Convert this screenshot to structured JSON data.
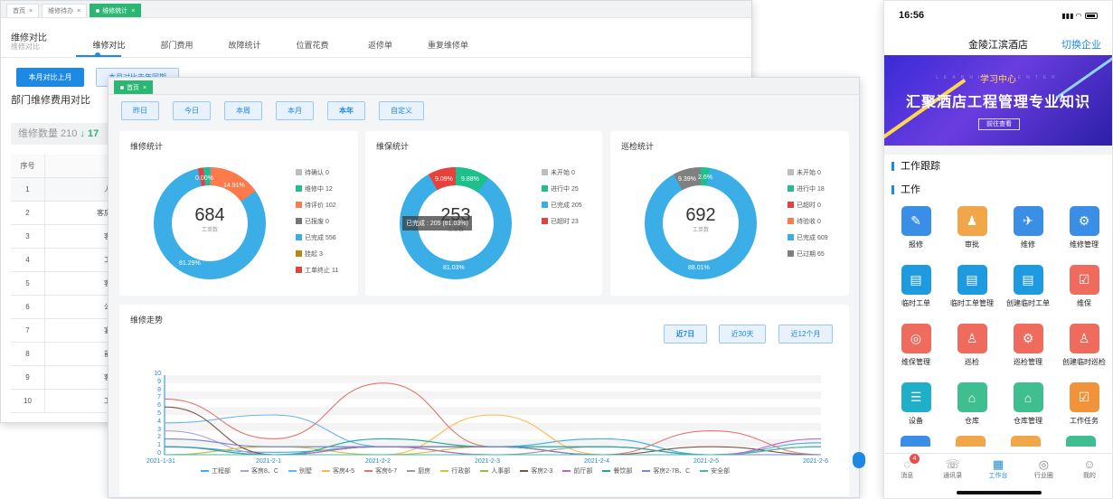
{
  "back_window": {
    "tabs": [
      {
        "label": "首页",
        "active": false
      },
      {
        "label": "维修待办",
        "active": false
      },
      {
        "label": "维修统计",
        "active": true
      }
    ],
    "title": "维修对比",
    "subtitle": "维修对比",
    "nav": [
      "维修对比",
      "部门费用",
      "故障统计",
      "位置花费",
      "返修单",
      "重复维修单"
    ],
    "btn_primary": "本月对比上月",
    "btn_secondary": "本月对比去年同期",
    "section_title": "部门维修费用对比",
    "count_label": "维修数量 210",
    "count_arrow": "↓",
    "count_trail": "17",
    "table_header": [
      "序号",
      ""
    ],
    "rows": [
      {
        "no": "1",
        "v": "人"
      },
      {
        "no": "2",
        "v": "客房"
      },
      {
        "no": "3",
        "v": "客"
      },
      {
        "no": "4",
        "v": "工"
      },
      {
        "no": "5",
        "v": "客"
      },
      {
        "no": "6",
        "v": "公"
      },
      {
        "no": "7",
        "v": "宴"
      },
      {
        "no": "8",
        "v": "前"
      },
      {
        "no": "9",
        "v": "客"
      },
      {
        "no": "10",
        "v": "工"
      }
    ]
  },
  "front_window": {
    "tab": "首页",
    "filters": [
      "昨日",
      "今日",
      "本周",
      "本月",
      "本年",
      "自定义"
    ],
    "cards": [
      {
        "title": "维修统计",
        "total": "684",
        "total_label": "工单数",
        "legend": [
          {
            "label": "待确认 0",
            "color": "#bdbdbd"
          },
          {
            "label": "维修中 12",
            "color": "#1dbf8a"
          },
          {
            "label": "待评价 102",
            "color": "#ff7a4a"
          },
          {
            "label": "已报废 0",
            "color": "#757575"
          },
          {
            "label": "已完成 556",
            "color": "#3baee8"
          },
          {
            "label": "挂起 3",
            "color": "#b8860b"
          },
          {
            "label": "工单终止 11",
            "color": "#e8413c"
          }
        ],
        "pcts": [
          "81.29%",
          "14.91%",
          "0.00%"
        ]
      },
      {
        "title": "维保统计",
        "total": "253",
        "total_label": "工单数",
        "legend": [
          {
            "label": "未开始 0",
            "color": "#bdbdbd"
          },
          {
            "label": "进行中 25",
            "color": "#1dbf8a"
          },
          {
            "label": "已完成 205",
            "color": "#3baee8"
          },
          {
            "label": "已超时 23",
            "color": "#e8413c"
          }
        ],
        "pcts": [
          "81.03%",
          "9.09%",
          "9.88%"
        ],
        "tooltip": "已完成 : 205 (81.03%)"
      },
      {
        "title": "巡检统计",
        "total": "692",
        "total_label": "工单数",
        "legend": [
          {
            "label": "未开始 0",
            "color": "#bdbdbd"
          },
          {
            "label": "进行中 18",
            "color": "#1dbf8a"
          },
          {
            "label": "已超时 0",
            "color": "#e8413c"
          },
          {
            "label": "待验收 0",
            "color": "#ff7a4a"
          },
          {
            "label": "已完成 609",
            "color": "#3baee8"
          },
          {
            "label": "已过期 65",
            "color": "#808080"
          }
        ],
        "pcts": [
          "88.01%",
          "9.39%",
          "2.6%"
        ]
      }
    ],
    "trend": {
      "title": "维修走势",
      "buttons": [
        "近7日",
        "近30天",
        "近12个月"
      ]
    }
  },
  "chart_data": {
    "type": "line",
    "title": "维修走势",
    "x": [
      "2021-1-31",
      "2021-2-1",
      "2021-2-2",
      "2021-2-3",
      "2021-2-4",
      "2021-2-5",
      "2021-2-6"
    ],
    "y_ticks": [
      "0",
      "1",
      "2",
      "3",
      "4",
      "5",
      "6",
      "7",
      "8",
      "9",
      "10"
    ],
    "ylim": [
      0,
      10
    ],
    "series": [
      {
        "name": "工程部",
        "color": "#3baee8",
        "values": [
          1,
          0.3,
          1,
          1,
          2,
          0,
          1.5
        ]
      },
      {
        "name": "客房8、C",
        "color": "#b39ddb",
        "values": [
          3,
          0,
          1,
          1,
          0,
          0,
          0
        ]
      },
      {
        "name": "别墅",
        "color": "#64b5f6",
        "values": [
          4,
          5,
          1,
          1,
          1,
          0,
          1
        ]
      },
      {
        "name": "客房4-5",
        "color": "#ffb74d",
        "values": [
          0,
          0,
          0,
          5,
          0,
          0,
          0
        ]
      },
      {
        "name": "客房6-7",
        "color": "#e57373",
        "values": [
          7,
          2,
          9,
          1,
          0,
          3,
          0
        ]
      },
      {
        "name": "厨房",
        "color": "#999999",
        "values": [
          0,
          1,
          1,
          0,
          1,
          0,
          1
        ]
      },
      {
        "name": "行政部",
        "color": "#d4c23a",
        "values": [
          0,
          1,
          0,
          1,
          0,
          0,
          1
        ]
      },
      {
        "name": "人事部",
        "color": "#8bc34a",
        "values": [
          0,
          0,
          1,
          0,
          0,
          0,
          0
        ]
      },
      {
        "name": "客房2-3",
        "color": "#795548",
        "values": [
          6,
          0,
          1,
          1,
          0,
          1,
          0
        ]
      },
      {
        "name": "前厅部",
        "color": "#ba68c8",
        "values": [
          1,
          0,
          1,
          0,
          0,
          0,
          2
        ]
      },
      {
        "name": "餐饮部",
        "color": "#26a69a",
        "values": [
          1,
          0,
          2,
          1,
          1,
          0,
          0
        ]
      },
      {
        "name": "客房2-7B、C",
        "color": "#7986cb",
        "values": [
          2,
          1,
          1,
          1,
          0,
          0,
          0
        ]
      },
      {
        "name": "安全部",
        "color": "#4db6ac",
        "values": [
          0,
          0,
          0,
          0,
          0,
          0,
          1
        ]
      }
    ]
  },
  "phone": {
    "time": "16:56",
    "hotel": "金陵江滨酒店",
    "switch": "切换企业",
    "banner_top": "学习中心",
    "banner_faint": "LEARNING CENTER",
    "banner_main": "汇聚酒店工程管理专业知识",
    "banner_btn": "前往查看",
    "section1": "工作跟踪",
    "section2": "工作",
    "apps": [
      {
        "label": "报修",
        "color": "#3a8ee6",
        "glyph": "✎"
      },
      {
        "label": "审批",
        "color": "#f2a64a",
        "glyph": "♟"
      },
      {
        "label": "维修",
        "color": "#3a8ee6",
        "glyph": "✈"
      },
      {
        "label": "维修管理",
        "color": "#3a8ee6",
        "glyph": "⚙"
      },
      {
        "label": "临时工单",
        "color": "#1e9be0",
        "glyph": "▤"
      },
      {
        "label": "临时工单管理",
        "color": "#1e9be0",
        "glyph": "▤"
      },
      {
        "label": "创建临时工单",
        "color": "#1e9be0",
        "glyph": "▤"
      },
      {
        "label": "维保",
        "color": "#ee6b5e",
        "glyph": "☑"
      },
      {
        "label": "维保管理",
        "color": "#ee6b5e",
        "glyph": "◎"
      },
      {
        "label": "巡检",
        "color": "#ee6b5e",
        "glyph": "♙"
      },
      {
        "label": "巡检管理",
        "color": "#ee6b5e",
        "glyph": "⚙"
      },
      {
        "label": "创建临时巡检",
        "color": "#ee6b5e",
        "glyph": "♙"
      },
      {
        "label": "设备",
        "color": "#1fb0c8",
        "glyph": "☰"
      },
      {
        "label": "仓库",
        "color": "#3fbf8f",
        "glyph": "⌂"
      },
      {
        "label": "仓库管理",
        "color": "#3fbf8f",
        "glyph": "⌂"
      },
      {
        "label": "工作任务",
        "color": "#f0933a",
        "glyph": "☑"
      }
    ],
    "partial_colors": [
      "#3a8ee6",
      "#f2a64a",
      "#f2a64a",
      "#3fbf8f"
    ],
    "tabs": [
      {
        "label": "消息",
        "glyph": "◌",
        "badge": "4"
      },
      {
        "label": "通讯录",
        "glyph": "☏"
      },
      {
        "label": "工作台",
        "glyph": "▦",
        "active": true
      },
      {
        "label": "行业圈",
        "glyph": "◎"
      },
      {
        "label": "我的",
        "glyph": "☺"
      }
    ]
  }
}
